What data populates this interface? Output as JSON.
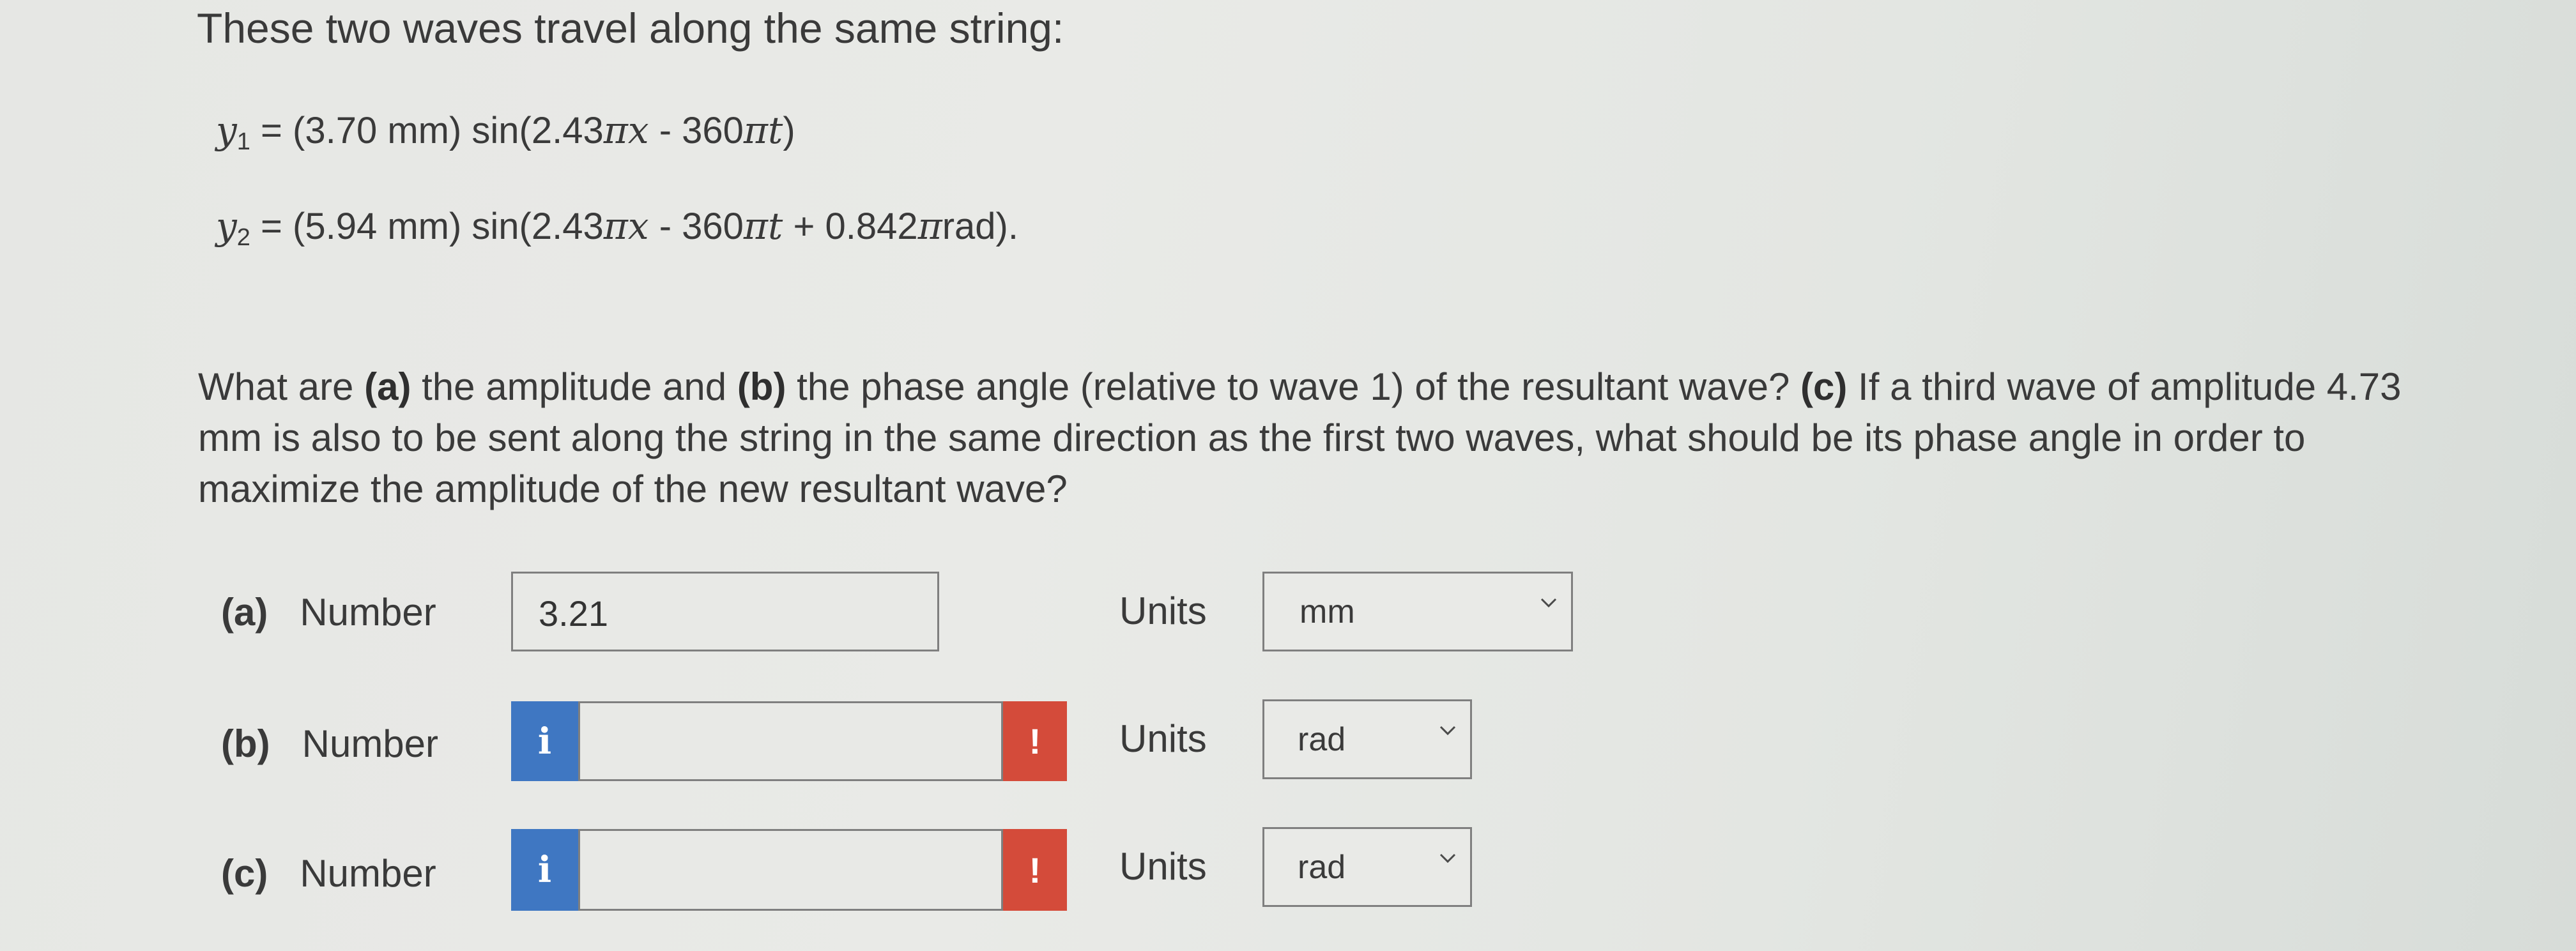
{
  "question": {
    "intro": "These two waves travel along the same string:",
    "eq1": {
      "lhs": "y",
      "sub": "1",
      "rest_a": " = (3.70 mm) sin(2.43",
      "pi1": "π",
      "x": "x",
      "rest_b": " - 360",
      "pi2": "π",
      "t": "t",
      "end": ")"
    },
    "eq2": {
      "lhs": "y",
      "sub": "2",
      "rest_a": " = (5.94 mm) sin(2.43",
      "pi1": "π",
      "x": "x",
      "rest_b": " - 360",
      "pi2": "π",
      "t": "t",
      "rest_c": " + 0.842",
      "pi3": "π",
      "end": "rad)."
    },
    "text": {
      "p1": "What are ",
      "a": "(a)",
      "p2": " the amplitude and ",
      "b": "(b)",
      "p3": " the phase angle (relative to wave 1) of the resultant wave? ",
      "c": "(c)",
      "p4": " If a third wave of amplitude 4.73 mm is also to be sent along the string in the same direction as the first two waves, what should be its phase angle in order to maximize the amplitude of the new resultant wave?"
    }
  },
  "answers": [
    {
      "part": "(a)",
      "label": "Number",
      "value": "3.21",
      "units_label": "Units",
      "unit": "mm"
    },
    {
      "part": "(b)",
      "label": "Number",
      "value": "",
      "info": "i",
      "warn": "!",
      "units_label": "Units",
      "unit": "rad"
    },
    {
      "part": "(c)",
      "label": "Number",
      "value": "",
      "info": "i",
      "warn": "!",
      "units_label": "Units",
      "unit": "rad"
    }
  ],
  "icons": {
    "info": "info-icon",
    "warning": "warning-icon",
    "dropdown": "chevron-down-icon"
  },
  "colors": {
    "info": "#3f77c2",
    "warning": "#d44b3a"
  }
}
